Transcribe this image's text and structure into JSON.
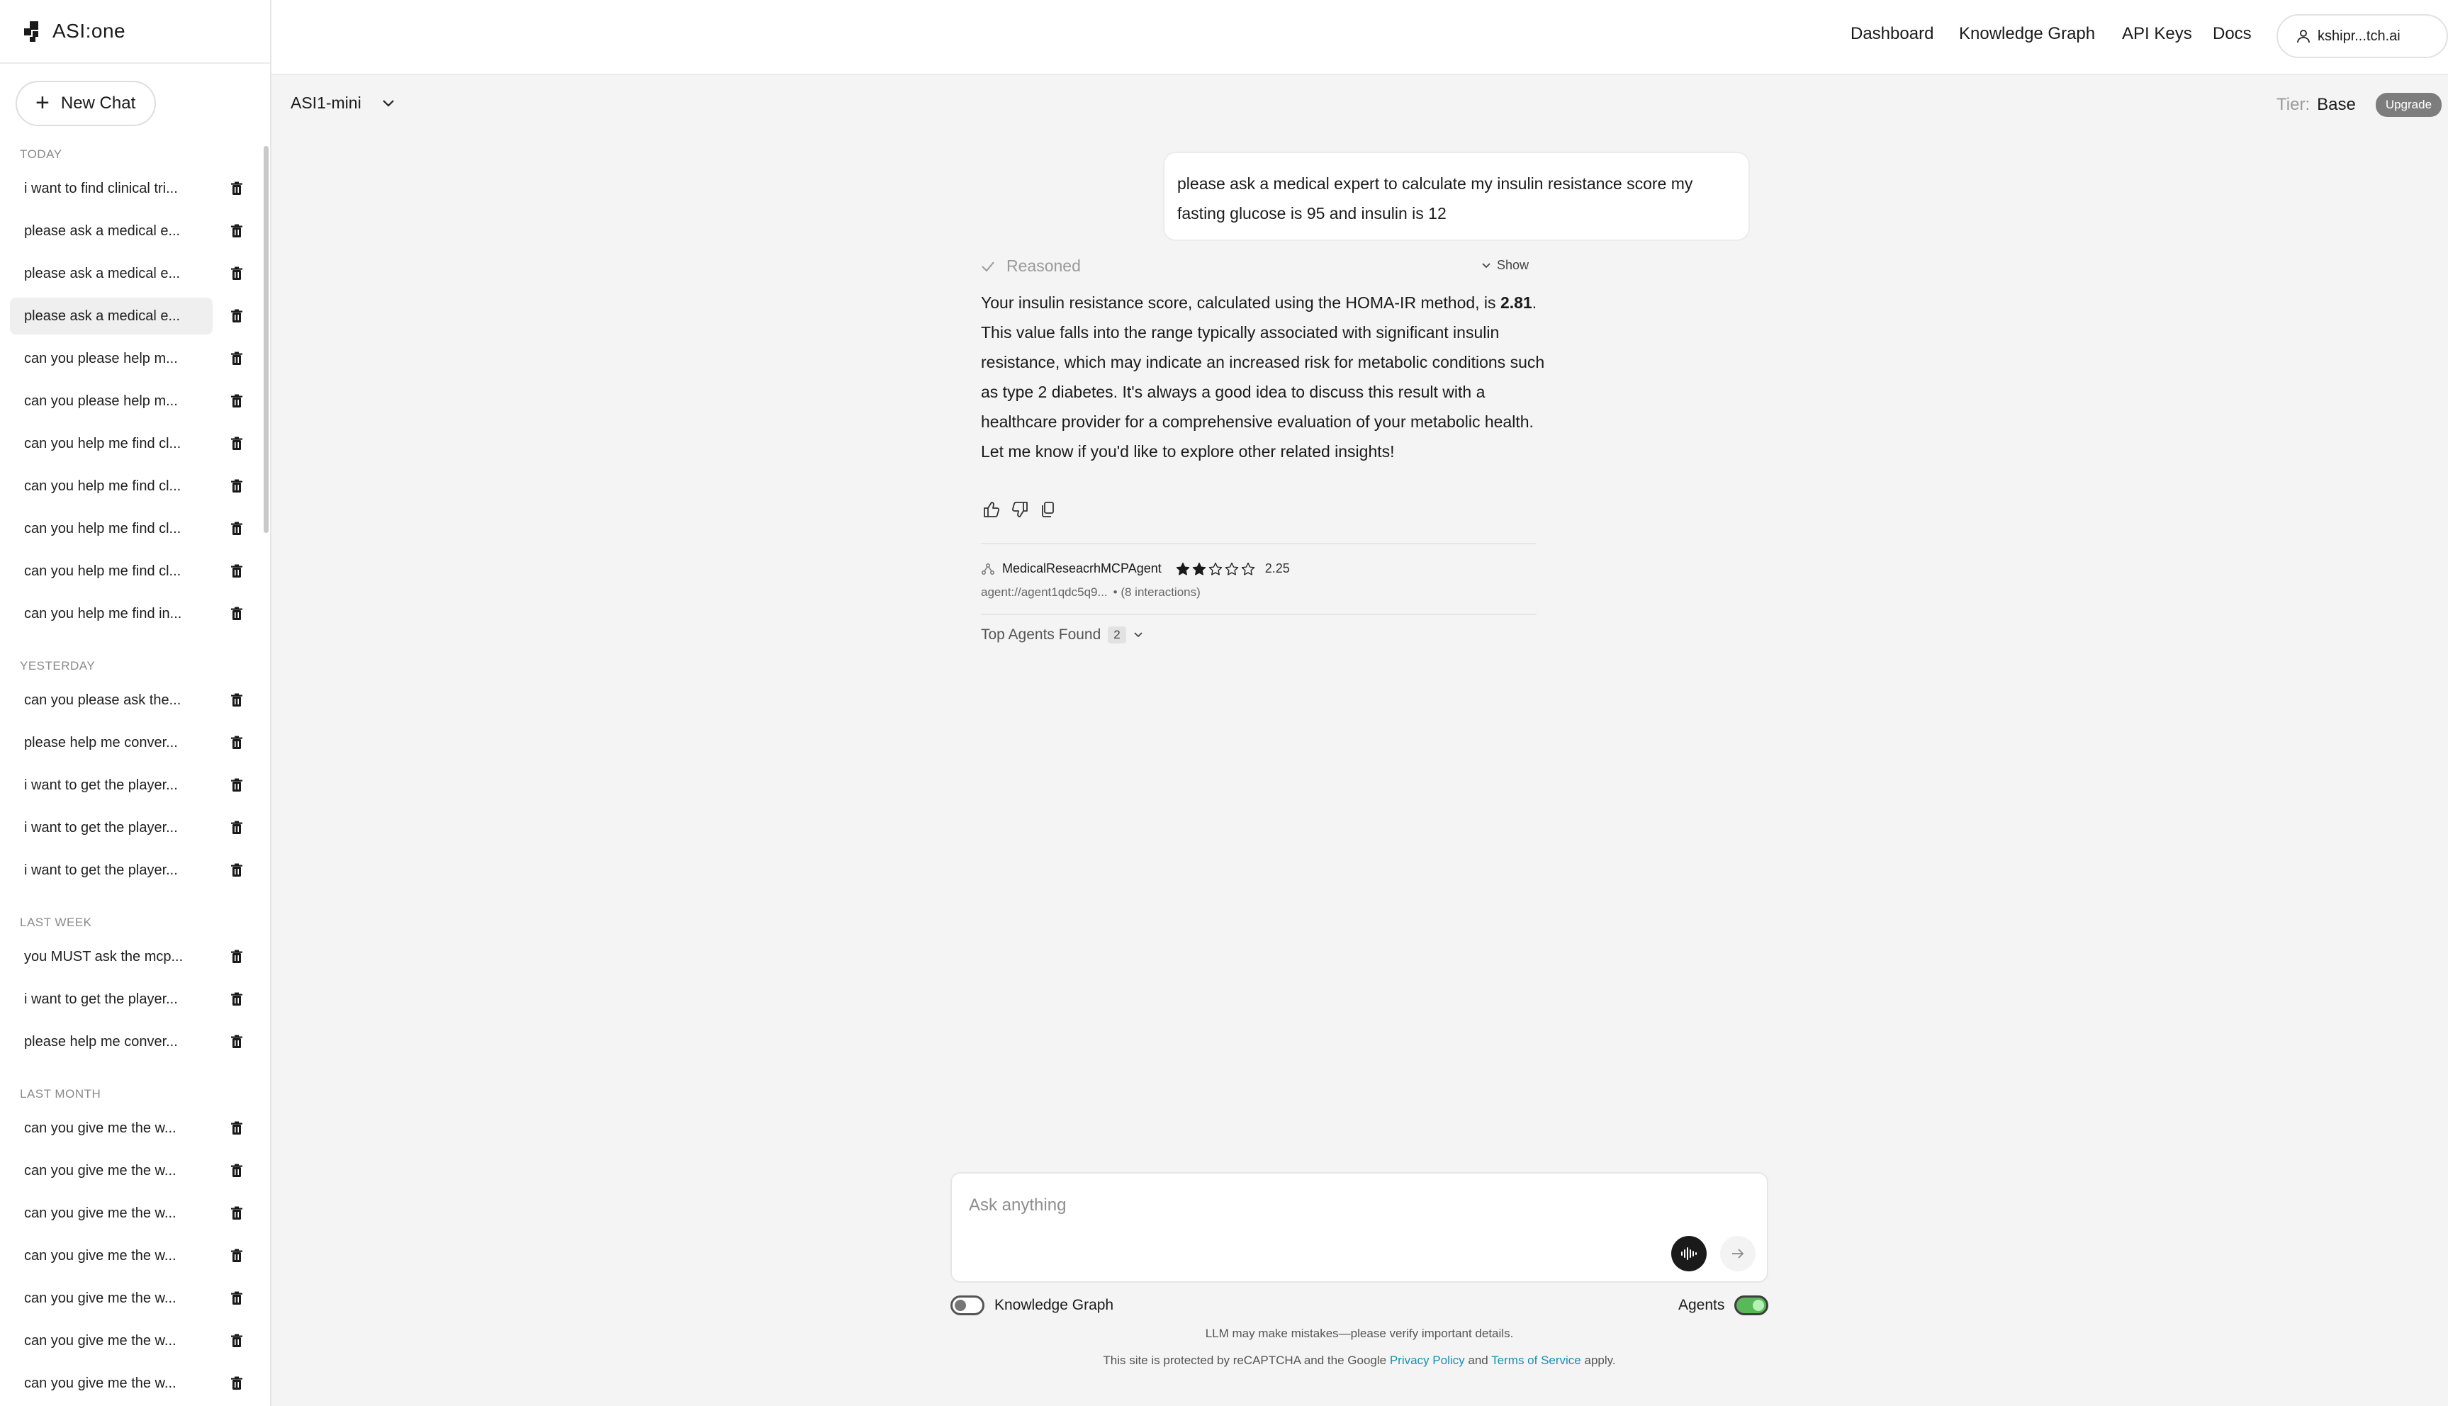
{
  "brand": {
    "name": "ASI:one"
  },
  "sidebar": {
    "new_chat_label": "New Chat",
    "sections": [
      {
        "title": "TODAY",
        "items": [
          "i want to find clinical tri...",
          "please ask a medical e...",
          "please ask a medical e...",
          "please ask a medical e...",
          "can you please help m...",
          "can you please help m...",
          "can you help me find cl...",
          "can you help me find cl...",
          "can you help me find cl...",
          "can you help me find cl...",
          "can you help me find in..."
        ]
      },
      {
        "title": "YESTERDAY",
        "items": [
          "can you please ask the...",
          "please help me conver...",
          "i want to get the player...",
          "i want to get the player...",
          "i want to get the player..."
        ]
      },
      {
        "title": "LAST WEEK",
        "items": [
          "you MUST ask the mcp...",
          "i want to get the player...",
          "please help me conver..."
        ]
      },
      {
        "title": "LAST MONTH",
        "items": [
          "can you give me the w...",
          "can you give me the w...",
          "can you give me the w...",
          "can you give me the w...",
          "can you give me the w...",
          "can you give me the w...",
          "can you give me the w..."
        ]
      }
    ]
  },
  "nav": {
    "links": [
      "Dashboard",
      "Knowledge Graph",
      "API Keys",
      "Docs"
    ],
    "user": "kshipr...tch.ai"
  },
  "model": {
    "selected": "ASI1-mini"
  },
  "tier": {
    "label": "Tier:",
    "value": "Base",
    "upgrade": "Upgrade"
  },
  "conversation": {
    "user_message": "please ask a medical expert to calculate my insulin resistance score my fasting glucose is 95 and insulin is 12",
    "reasoned_label": "Reasoned",
    "show_label": "Show",
    "answer_intro": "Your insulin resistance score, calculated using the HOMA-IR method, is",
    "answer_value": "2.81",
    "answer_rest": ". This value falls into the range typically associated with significant insulin resistance, which may indicate an increased risk for metabolic conditions such as type 2 diabetes. It's always a good idea to discuss this result with a healthcare provider for a comprehensive evaluation of your metabolic health. Let me know if you'd like to explore other related insights!",
    "agent": {
      "name": "MedicalReseacrhMCPAgent",
      "rating": 2.25,
      "rating_text": "2.25",
      "address": "agent://agent1qdc5q9...",
      "interactions": "• (8 interactions)"
    },
    "top_agents_label": "Top Agents Found",
    "top_agents_count": "2"
  },
  "composer": {
    "placeholder": "Ask anything",
    "knowledge_graph_label": "Knowledge Graph",
    "knowledge_graph_on": false,
    "agents_label": "Agents",
    "agents_on": true
  },
  "footer": {
    "disclaimer": "LLM may make mistakes—please verify important details.",
    "recaptcha_prefix": "This site is protected by reCAPTCHA and the Google",
    "privacy": "Privacy Policy",
    "and": "and",
    "terms": "Terms of Service",
    "apply": "apply."
  },
  "colors": {
    "accent_link": "#1a8fb0",
    "toggle_on": "#57b957",
    "badge": "#7d7d7d"
  }
}
